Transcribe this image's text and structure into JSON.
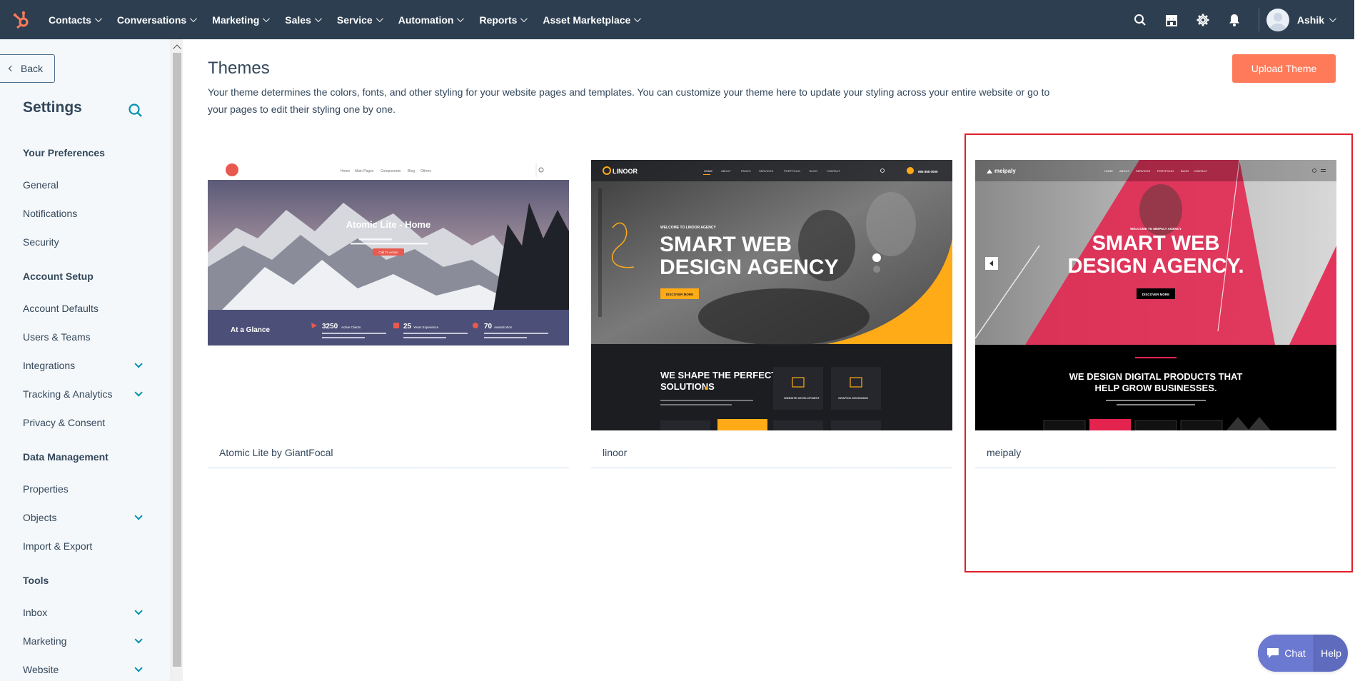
{
  "topnav": {
    "logo_icon": "hubspot-sprocket-icon",
    "menu": [
      {
        "label": "Contacts"
      },
      {
        "label": "Conversations"
      },
      {
        "label": "Marketing"
      },
      {
        "label": "Sales"
      },
      {
        "label": "Service"
      },
      {
        "label": "Automation"
      },
      {
        "label": "Reports"
      },
      {
        "label": "Asset Marketplace"
      }
    ],
    "icons": [
      "search-icon",
      "marketplace-icon",
      "gear-icon",
      "bell-icon"
    ],
    "user_name": "Ashik"
  },
  "sidebar": {
    "back_label": "Back",
    "title": "Settings",
    "sections": [
      {
        "label": "Your Preferences",
        "items": [
          {
            "label": "General"
          },
          {
            "label": "Notifications"
          },
          {
            "label": "Security"
          }
        ]
      },
      {
        "label": "Account Setup",
        "items": [
          {
            "label": "Account Defaults"
          },
          {
            "label": "Users & Teams"
          },
          {
            "label": "Integrations"
          },
          {
            "label": "Tracking & Analytics"
          },
          {
            "label": "Privacy & Consent"
          }
        ]
      },
      {
        "label": "Data Management",
        "items": [
          {
            "label": "Properties"
          },
          {
            "label": "Objects"
          },
          {
            "label": "Import & Export"
          }
        ]
      },
      {
        "label": "Tools",
        "items": [
          {
            "label": "Inbox"
          },
          {
            "label": "Marketing"
          },
          {
            "label": "Website"
          }
        ]
      }
    ]
  },
  "main": {
    "title": "Themes",
    "description": "Your theme determines the colors, fonts, and other styling for your website pages and templates. You can customize your theme here to update your styling across your entire website or go to your pages to edit their styling one by one.",
    "upload_label": "Upload Theme",
    "themes": [
      {
        "name": "Atomic Lite by GiantFocal",
        "preview": {
          "nav_links": [
            "Home",
            "Main Pages",
            "Components",
            "Blog",
            "Others"
          ],
          "hero_title": "Atomic Lite - Home",
          "cta": "Call To Action",
          "band_title": "At a Glance",
          "stats": [
            {
              "value": "3250",
              "label": "Active Clients"
            },
            {
              "value": "25",
              "label": "Years Experience"
            },
            {
              "value": "70",
              "label": "Awards Won"
            }
          ]
        }
      },
      {
        "name": "linoor",
        "preview": {
          "brand": "LINOOR",
          "nav_links": [
            "HOME",
            "ABOUT",
            "PAGES",
            "SERVICES",
            "PORTFOLIO",
            "BLOG",
            "CONTACT"
          ],
          "eyebrow": "WELCOME TO LINOOR AGENCY",
          "hero_line1": "SMART WEB",
          "hero_line2": "DESIGN AGENCY",
          "cta": "DISCOVER MORE",
          "section_line1": "WE SHAPE THE PERFECT",
          "section_line2": "SOLUTIONS",
          "service1": "WEBSITE DEVELOPMENT",
          "service2": "GRAPHIC DESIGNING",
          "phone": "666 888 0000"
        }
      },
      {
        "name": "meipaly",
        "preview": {
          "brand": "meipaly",
          "nav_links": [
            "HOME",
            "ABOUT",
            "SERVICES",
            "PORTFOLIO",
            "BLOG",
            "CONTACT"
          ],
          "eyebrow": "WELCOME TO MEIPALY AGENCY",
          "hero_line1": "SMART WEB",
          "hero_line2": "DESIGN AGENCY.",
          "cta": "DISCOVER MORE",
          "section_line1": "WE DESIGN DIGITAL PRODUCTS THAT",
          "section_line2": "HELP GROW BUSINESSES."
        }
      }
    ]
  },
  "chat_widget": {
    "chat_label": "Chat",
    "help_label": "Help"
  },
  "colors": {
    "nav_bg": "#2d3e50",
    "accent": "#ff7a59",
    "link": "#0091ae",
    "highlight": "#e01e2b",
    "linoor_yellow": "#ffaa17",
    "meipaly_red": "#e4234f"
  }
}
